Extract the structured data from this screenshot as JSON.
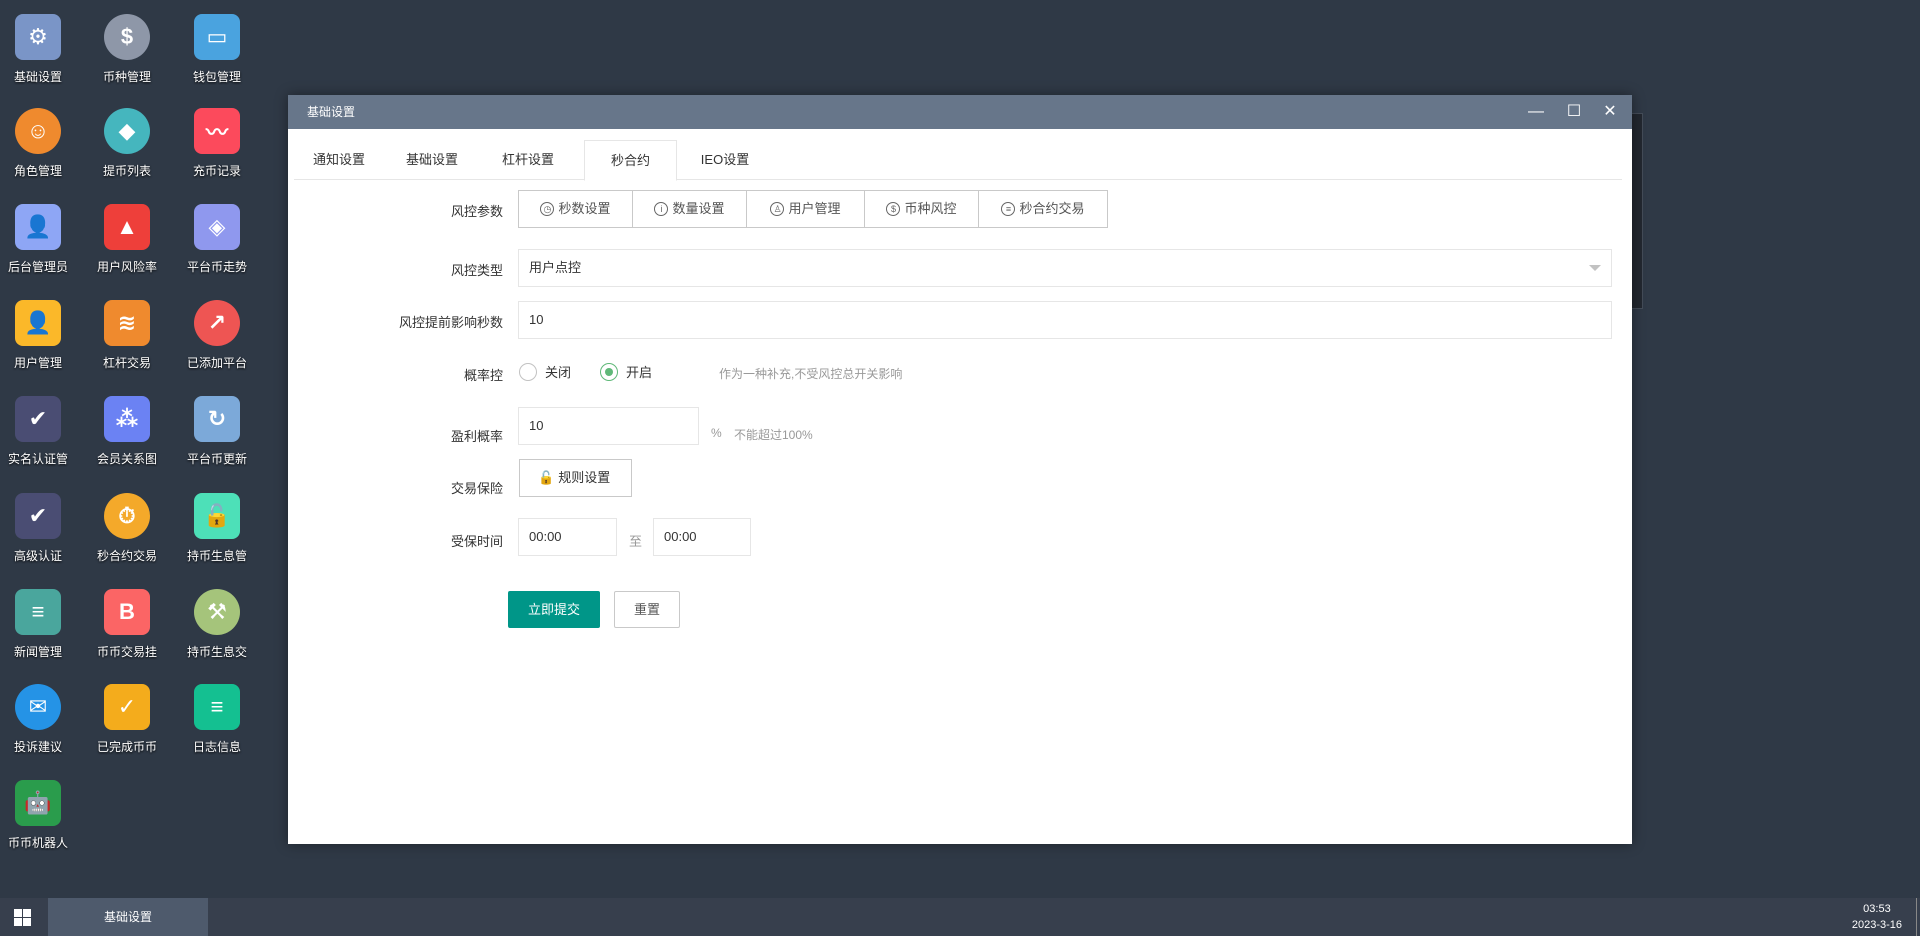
{
  "desktop": {
    "icons": [
      {
        "label": "基础设置",
        "icon": "gear-icon",
        "color": "#7a95c7",
        "glyph": "⚙"
      },
      {
        "label": "币种管理",
        "icon": "dollar-icon",
        "color": "#8e97a8",
        "glyph": "$"
      },
      {
        "label": "钱包管理",
        "icon": "wallet-icon",
        "color": "#4aa3df",
        "glyph": "▭"
      },
      {
        "label": "角色管理",
        "icon": "role-icon",
        "color": "#ef8a2e",
        "glyph": "☺"
      },
      {
        "label": "提币列表",
        "icon": "coin-icon",
        "color": "#45b6be",
        "glyph": "◆"
      },
      {
        "label": "充币记录",
        "icon": "phone-chart-icon",
        "color": "#fc4a5c",
        "glyph": "〰"
      },
      {
        "label": "后台管理员",
        "icon": "admin-icon",
        "color": "#8ea6f5",
        "glyph": "👤"
      },
      {
        "label": "用户风险率",
        "icon": "alarm-icon",
        "color": "#ee3f3a",
        "glyph": "▲"
      },
      {
        "label": "平台币走势",
        "icon": "layers-icon",
        "color": "#8f98ee",
        "glyph": "◈"
      },
      {
        "label": "用户管理",
        "icon": "user-search-icon",
        "color": "#fbb829",
        "glyph": "👤"
      },
      {
        "label": "杠杆交易",
        "icon": "stack-icon",
        "color": "#ef8a2e",
        "glyph": "≋"
      },
      {
        "label": "已添加平台",
        "icon": "trend-icon",
        "color": "#ee5553",
        "glyph": "↗"
      },
      {
        "label": "实名认证管",
        "icon": "verify-icon",
        "color": "#4a4d73",
        "glyph": "✔"
      },
      {
        "label": "会员关系图",
        "icon": "network-icon",
        "color": "#6b82f3",
        "glyph": "⁂"
      },
      {
        "label": "平台币更新",
        "icon": "cloud-refresh-icon",
        "color": "#7ca9d9",
        "glyph": "↻"
      },
      {
        "label": "高级认证",
        "icon": "verify-icon",
        "color": "#4a4d73",
        "glyph": "✔"
      },
      {
        "label": "秒合约交易",
        "icon": "stopwatch-icon",
        "color": "#f4a92a",
        "glyph": "⏱"
      },
      {
        "label": "持币生息管",
        "icon": "unlock-icon",
        "color": "#4de0b8",
        "glyph": "🔓"
      },
      {
        "label": "新闻管理",
        "icon": "document-icon",
        "color": "#4aa69d",
        "glyph": "≡"
      },
      {
        "label": "币币交易挂",
        "icon": "bitcoin-icon",
        "color": "#fb6565",
        "glyph": "B"
      },
      {
        "label": "持币生息交",
        "icon": "hammer-icon",
        "color": "#a5c47b",
        "glyph": "⚒"
      },
      {
        "label": "投诉建议",
        "icon": "mail-icon",
        "color": "#2593e6",
        "glyph": "✉"
      },
      {
        "label": "已完成币币",
        "icon": "check-calendar-icon",
        "color": "#f4ac1c",
        "glyph": "✓"
      },
      {
        "label": "日志信息",
        "icon": "log-clock-icon",
        "color": "#14c091",
        "glyph": "≡"
      },
      {
        "label": "币币机器人",
        "icon": "robot-icon",
        "color": "#2a9c4c",
        "glyph": "🤖"
      }
    ]
  },
  "window": {
    "title": "基础设置",
    "minimize": "—",
    "maximize": "☐",
    "close": "✕"
  },
  "tabs": [
    "通知设置",
    "基础设置",
    "杠杆设置",
    "秒合约",
    "IEO设置"
  ],
  "form": {
    "risk_params_label": "风控参数",
    "risk_buttons": [
      {
        "label": "秒数设置",
        "icon": "clock-icon",
        "glyph": "◷"
      },
      {
        "label": "数量设置",
        "icon": "info-icon",
        "glyph": "i"
      },
      {
        "label": "用户管理",
        "icon": "user-icon",
        "glyph": "♙"
      },
      {
        "label": "币种风控",
        "icon": "dollar-icon",
        "glyph": "$"
      },
      {
        "label": "秒合约交易",
        "icon": "clipboard-icon",
        "glyph": "≡"
      }
    ],
    "risk_type_label": "风控类型",
    "risk_type_value": "用户点控",
    "advance_label": "风控提前影响秒数",
    "advance_value": "10",
    "prob_label": "概率控",
    "prob_off": "关闭",
    "prob_on": "开启",
    "prob_selected": "开启",
    "prob_hint": "作为一种补充,不受风控总开关影响",
    "profit_label": "盈利概率",
    "profit_value": "10",
    "profit_unit": "%",
    "profit_hint": "不能超过100%",
    "insurance_label": "交易保险",
    "insurance_button": "规则设置",
    "time_label": "受保时间",
    "time_start": "00:00",
    "time_sep": "至",
    "time_end": "00:00",
    "submit": "立即提交",
    "reset": "重置"
  },
  "taskbar": {
    "task": "基础设置",
    "time": "03:53",
    "date": "2023-3-16"
  },
  "colors": {
    "accent": "#009688",
    "titlebar": "#67768a",
    "desktop": "#2f3946",
    "radio": "#5fb878"
  }
}
